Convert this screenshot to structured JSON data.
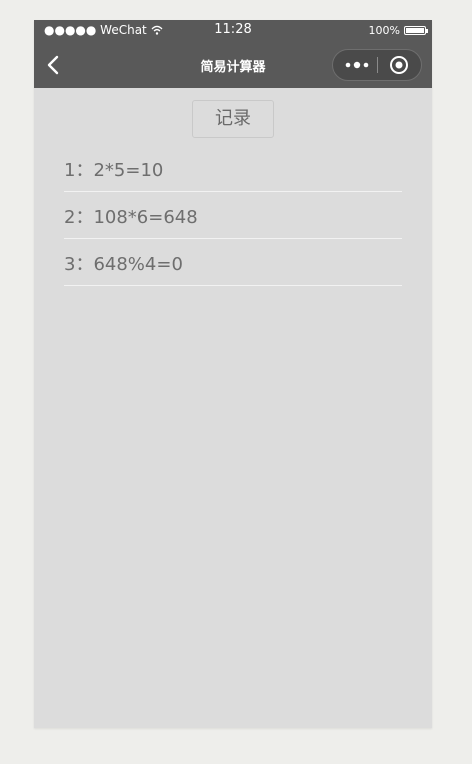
{
  "status_bar": {
    "carrier": "●●●●● WeChat",
    "wifi_icon": "wifi-icon",
    "time": "11:28",
    "battery_percent": "100%",
    "battery_level": 1.0
  },
  "nav": {
    "title": "简易计算器",
    "back_icon": "chevron-left-icon",
    "more_icon": "more-dots-icon",
    "close_icon": "target-circle-icon"
  },
  "main": {
    "record_button_label": "记录",
    "records": [
      {
        "index": "1：",
        "expression": "2*5=10"
      },
      {
        "index": "2：",
        "expression": "108*6=648"
      },
      {
        "index": "3：",
        "expression": "648%4=0"
      }
    ]
  },
  "colors": {
    "nav_background": "#595959",
    "page_background": "#dcdcdc",
    "text": "#6e6e6e",
    "divider": "#f2f2f2"
  }
}
